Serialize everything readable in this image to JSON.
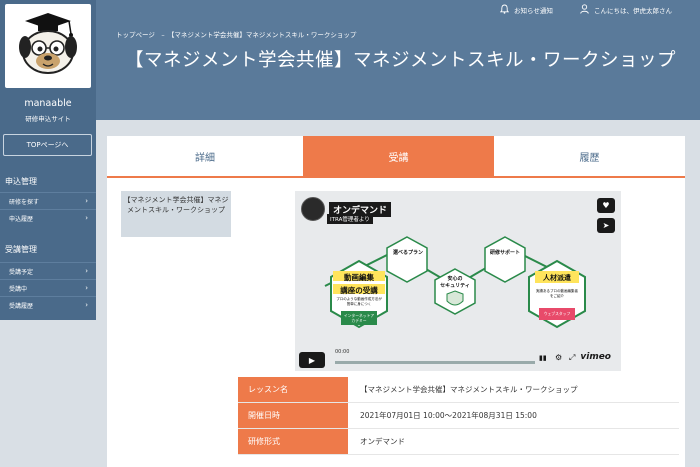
{
  "sidebar": {
    "site_name": "manaable",
    "site_sub": "研修申込サイト",
    "top_button": "TOPページへ",
    "sections": [
      {
        "title": "申込管理",
        "items": [
          "研修を探す",
          "申込履歴"
        ]
      },
      {
        "title": "受講管理",
        "items": [
          "受講予定",
          "受講中",
          "受講履歴"
        ]
      }
    ]
  },
  "topbar": {
    "notice": "お知らせ通知",
    "greeting": "こんにちは、伊虎太郎さん"
  },
  "header": {
    "breadcrumb": "トップページ　–　【マネジメント学会共催】マネジメントスキル・ワークショップ",
    "title": "【マネジメント学会共催】マネジメントスキル・ワークショップ"
  },
  "tabs": [
    "詳細",
    "受講",
    "履歴"
  ],
  "active_tab": "受講",
  "course_card": "【マネジメント学会共催】マネジメントスキル・ワークショップ",
  "video": {
    "channel_title": "オンデマンド",
    "by_line": "ITRA管理者より",
    "time": "00:00",
    "brand": "vimeo",
    "heading_line1": "動画編集",
    "heading_line2": "講座の受講",
    "sub_text": "プロのような動画作成方法が簡単に身につく",
    "tag_academy": "インターネットアカデミー",
    "hex_plan": "選べるプラン",
    "hex_security_1": "安心の",
    "hex_security_2": "セキュリティ",
    "hex_support": "研修サポート",
    "hex_dispatch": "人材派遣",
    "dispatch_sub": "実績あるプロの動画編集者をご紹介",
    "tag_webstaff": "ウェブスタッフ"
  },
  "info": [
    {
      "label": "レッスン名",
      "value": "【マネジメント学会共催】マネジメントスキル・ワークショップ"
    },
    {
      "label": "開催日時",
      "value": "2021年07月01日 10:00〜2021年08月31日 15:00"
    },
    {
      "label": "研修形式",
      "value": "オンデマンド"
    }
  ],
  "colors": {
    "accent": "#ee7a4a",
    "navy": "#4a6a8a",
    "header": "#5a7a9a"
  }
}
